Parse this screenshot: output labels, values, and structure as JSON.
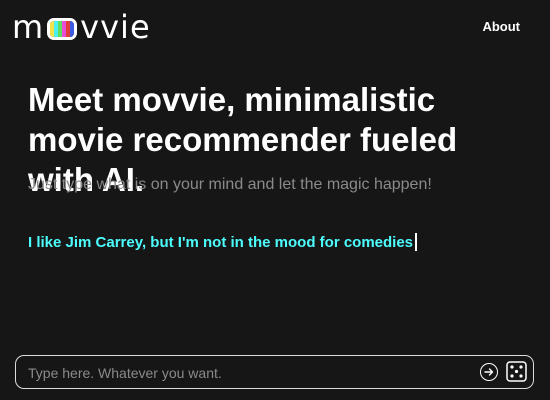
{
  "header": {
    "logo_prefix": "m",
    "logo_suffix": "vvie",
    "logo_colors": [
      "#f5e14a",
      "#4df0f0",
      "#5ee05e",
      "#e84fd8",
      "#e33b3b",
      "#3b5be3"
    ],
    "about_label": "About"
  },
  "hero": {
    "headline": "Meet movvie, minimalistic movie recommender fueled with AI.",
    "subline": "Just type what is on your mind and let the magic happen!",
    "typed_example": "I like Jim Carrey, but I'm not in the mood for comedies",
    "typed_color": "#4dfdfd"
  },
  "input": {
    "value": "",
    "placeholder": "Type here. Whatever you want."
  },
  "icons": {
    "send": "arrow-right-circle-icon",
    "random": "dice-icon"
  }
}
